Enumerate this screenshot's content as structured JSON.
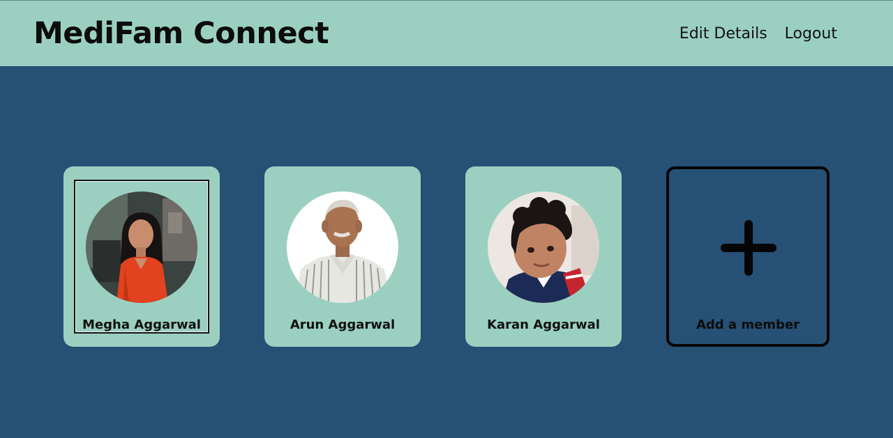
{
  "header": {
    "brand": "MediFam Connect",
    "links": [
      {
        "label": "Edit Details"
      },
      {
        "label": "Logout"
      }
    ]
  },
  "members": [
    {
      "name": "Megha Aggarwal",
      "selected": true
    },
    {
      "name": "Arun Aggarwal",
      "selected": false
    },
    {
      "name": "Karan Aggarwal",
      "selected": false
    }
  ],
  "add_member": {
    "label": "Add a member",
    "icon": "plus-icon"
  },
  "colors": {
    "header_bg": "#9bd0c1",
    "page_bg": "#265074",
    "card_bg": "#9bd0c1"
  }
}
